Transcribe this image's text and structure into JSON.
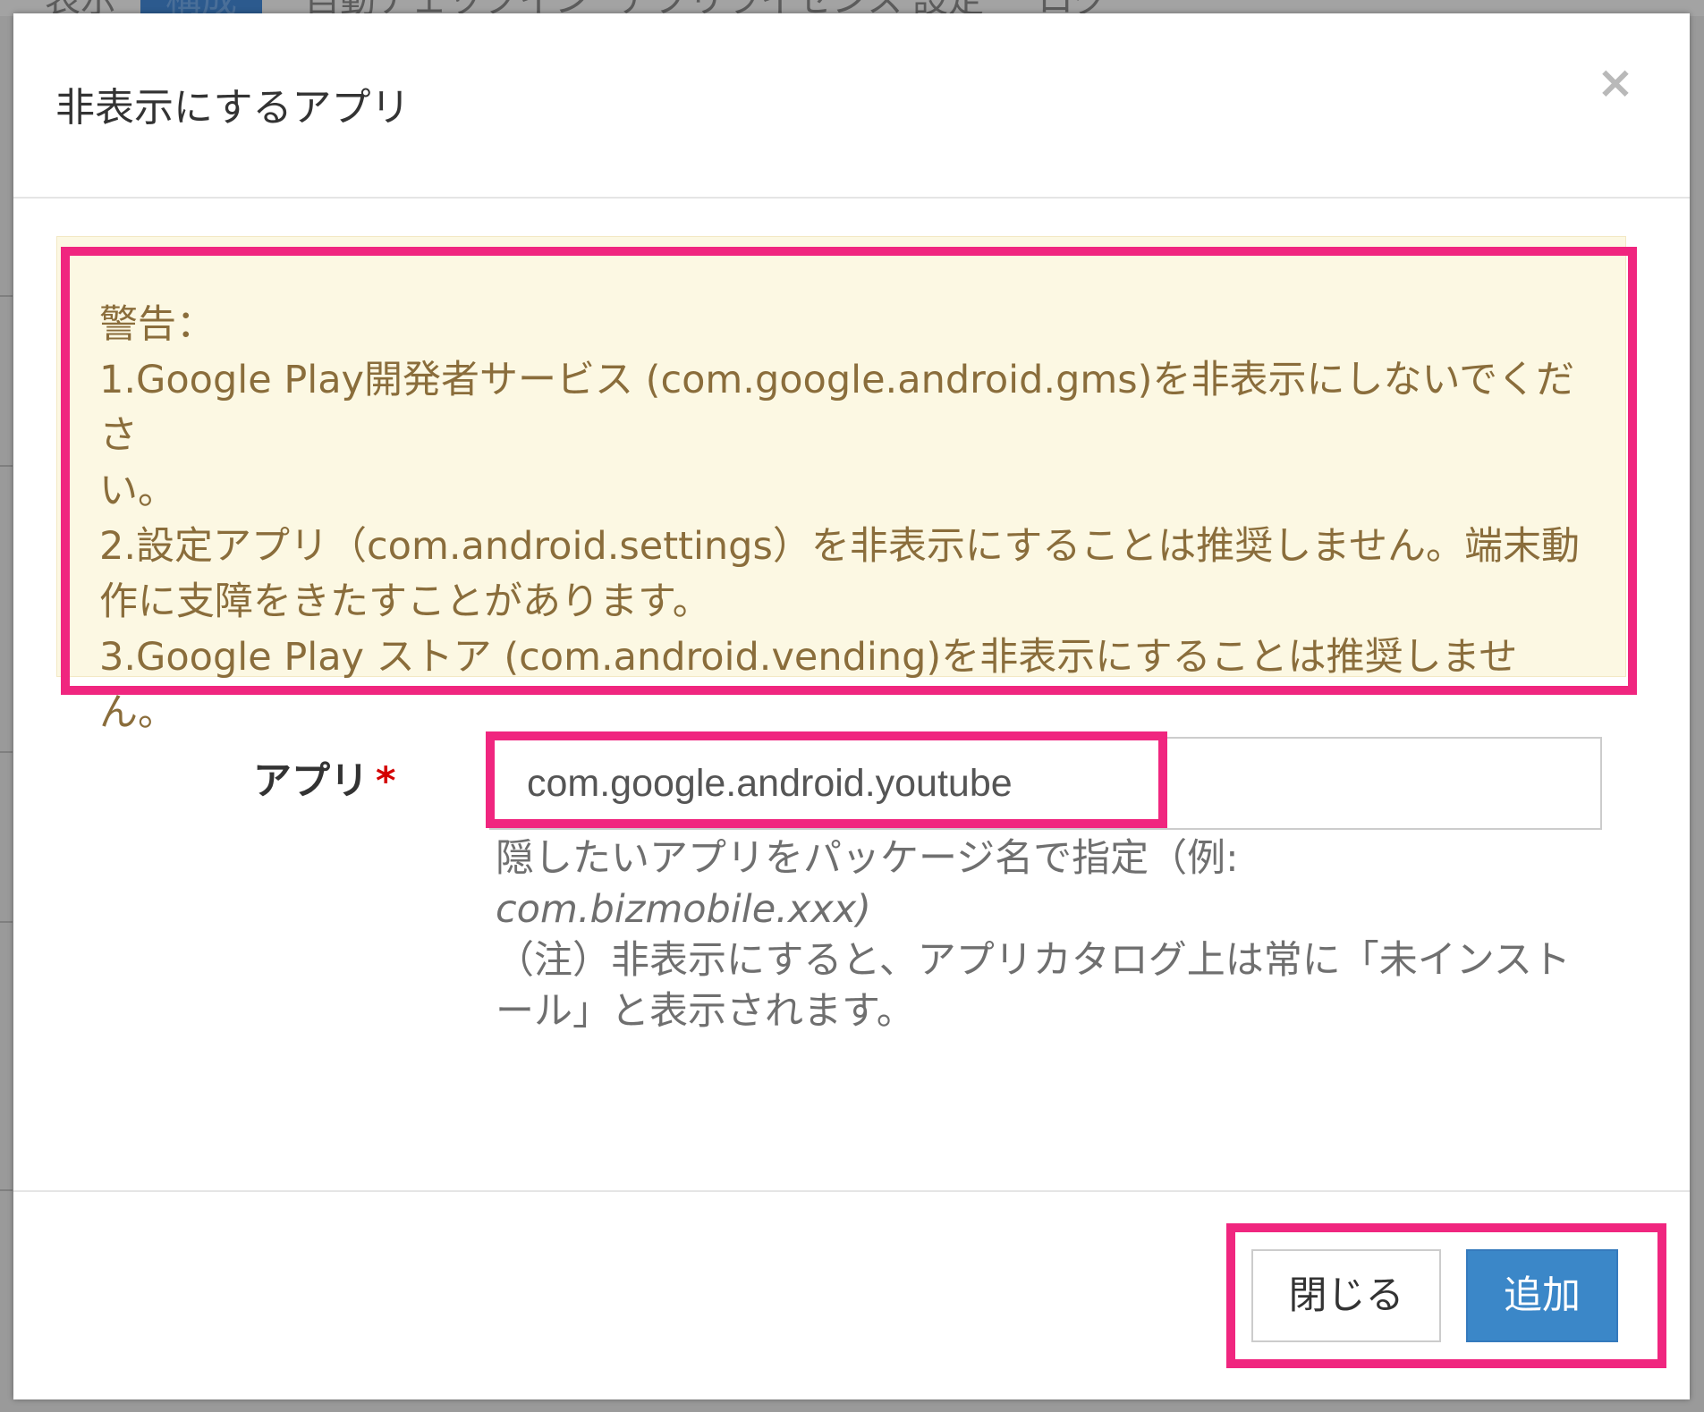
{
  "background": {
    "tabs": [
      "表示",
      "構成",
      "自動チェックイン",
      "アプリライセンス",
      "設定",
      "ログ"
    ]
  },
  "modal": {
    "title": "非表示にするアプリ",
    "close_icon": "×",
    "warning": {
      "heading": "警告：",
      "line1a": "1.Google Play開発者サービス (com.google.android.gms)を非表示にしないでくださ",
      "line1b": "い。",
      "line2a": "2.設定アプリ（com.android.settings）を非表示にすることは推奨しません。端末動",
      "line2b": "作に支障をきたすことがあります。",
      "line3": "3.Google Play ストア (com.android.vending)を非表示にすることは推奨しません。"
    },
    "form": {
      "label": "アプリ",
      "required_mark": "*",
      "input_value": "com.google.android.youtube",
      "help_line1": "隠したいアプリをパッケージ名で指定（例:",
      "help_line2": "com.bizmobile.xxx)",
      "help_line3": "（注）非表示にすると、アプリカタログ上は常に「未インスト",
      "help_line4": "ール」と表示されます。"
    },
    "footer": {
      "close_label": "閉じる",
      "add_label": "追加"
    }
  },
  "colors": {
    "highlight": "#f0267f",
    "warning_bg": "#fcf8e3",
    "warning_text": "#8a6d3b",
    "primary": "#3b87c8"
  }
}
